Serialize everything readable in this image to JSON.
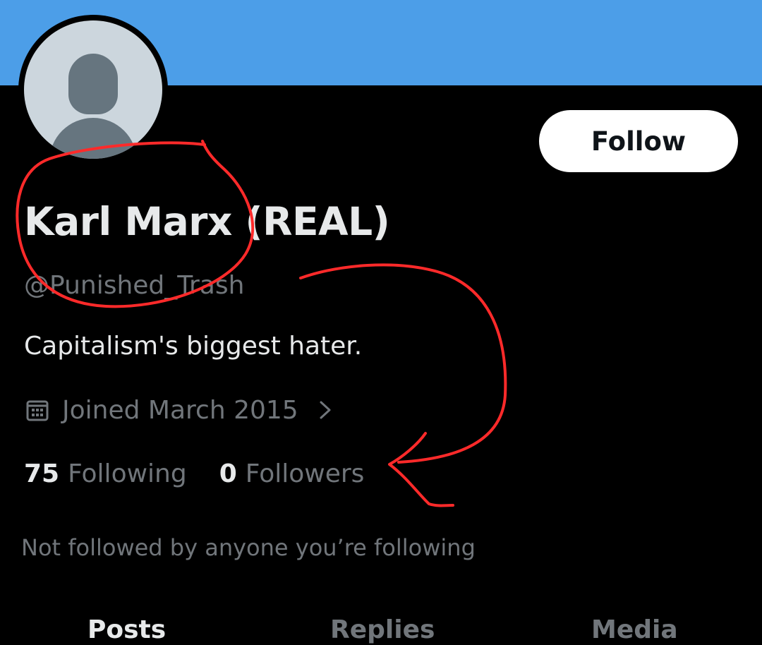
{
  "profile": {
    "display_name": "Karl Marx (REAL)",
    "handle": "@Punished_Trash",
    "bio": "Capitalism's biggest hater.",
    "joined": "Joined March 2015",
    "follow_label": "Follow"
  },
  "stats": {
    "following_count": "75",
    "following_label": "Following",
    "followers_count": "0",
    "followers_label": "Followers"
  },
  "social_context": "Not followed by anyone you’re following",
  "tabs": [
    {
      "label": "Posts",
      "active": true
    },
    {
      "label": "Replies",
      "active": false
    },
    {
      "label": "Media",
      "active": false
    }
  ],
  "colors": {
    "banner": "#4c9ee8",
    "background": "#000000",
    "primary_text": "#e7e9ea",
    "secondary_text": "#71767b",
    "annotation_ink": "#ff2a2a"
  },
  "icons": {
    "calendar": "calendar-icon",
    "chevron": "chevron-right-icon",
    "avatar": "default-avatar-icon"
  }
}
